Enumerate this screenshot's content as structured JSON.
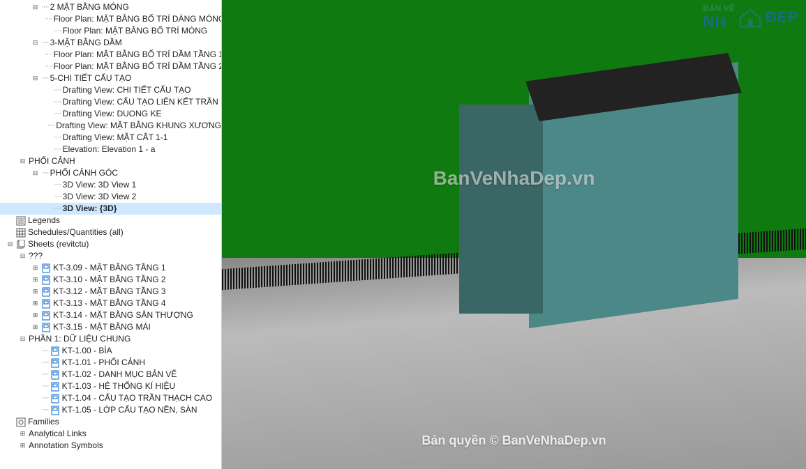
{
  "tree": [
    {
      "indent": 3,
      "exp": "minus",
      "label": "2 MẶT BẰNG MÓNG",
      "dotted": true
    },
    {
      "indent": 4,
      "exp": "none",
      "label": "Floor Plan: MẶT BẰNG BỐ TRÍ DÀNG MÓNG",
      "dotted": true
    },
    {
      "indent": 4,
      "exp": "none",
      "label": "Floor Plan: MẶT BẰNG BỐ TRÍ MÓNG",
      "dotted": true
    },
    {
      "indent": 3,
      "exp": "minus",
      "label": "3-MẶT BẰNG DẦM",
      "dotted": true
    },
    {
      "indent": 4,
      "exp": "none",
      "label": "Floor Plan: MẶT BẰNG BỐ TRÍ DẦM TẦNG 1",
      "dotted": true
    },
    {
      "indent": 4,
      "exp": "none",
      "label": "Floor Plan: MẶT BẰNG BỐ TRÍ DẦM TẦNG 2",
      "dotted": true
    },
    {
      "indent": 3,
      "exp": "minus",
      "label": "5-CHI TIẾT CẤU TẠO",
      "dotted": true
    },
    {
      "indent": 4,
      "exp": "none",
      "label": "Drafting View: CHI TIẾT CẤU TẠO",
      "dotted": true
    },
    {
      "indent": 4,
      "exp": "none",
      "label": "Drafting View: CẤU TẠO LIÊN KẾT TRẦN",
      "dotted": true
    },
    {
      "indent": 4,
      "exp": "none",
      "label": "Drafting View: DUONG KE",
      "dotted": true
    },
    {
      "indent": 4,
      "exp": "none",
      "label": "Drafting View: MẶT BẰNG KHUNG XƯƠNG",
      "dotted": true
    },
    {
      "indent": 4,
      "exp": "none",
      "label": "Drafting View: MẶT CẮT 1-1",
      "dotted": true
    },
    {
      "indent": 4,
      "exp": "none",
      "label": "Elevation: Elevation 1 - a",
      "dotted": true
    },
    {
      "indent": 2,
      "exp": "minus",
      "label": "PHỐI CẢNH",
      "dotted": false
    },
    {
      "indent": 3,
      "exp": "minus",
      "label": "PHỐI CẢNH GÓC",
      "dotted": true
    },
    {
      "indent": 4,
      "exp": "none",
      "label": "3D View: 3D View 1",
      "dotted": true
    },
    {
      "indent": 4,
      "exp": "none",
      "label": "3D View: 3D View 2",
      "dotted": true
    },
    {
      "indent": 4,
      "exp": "none",
      "label": "3D View: {3D}",
      "dotted": true,
      "selected": true
    },
    {
      "indent": 1,
      "exp": "none",
      "icon": "legend",
      "label": "Legends",
      "dotted": false
    },
    {
      "indent": 1,
      "exp": "none",
      "icon": "sched",
      "label": "Schedules/Quantities (all)",
      "dotted": false
    },
    {
      "indent": 1,
      "exp": "minus",
      "icon": "sheets",
      "label": "Sheets (revitctu)",
      "dotted": false
    },
    {
      "indent": 2,
      "exp": "minus",
      "label": "???",
      "dotted": false
    },
    {
      "indent": 3,
      "exp": "plus",
      "icon": "sheet",
      "label": "KT-3.09 - MẶT BẰNG TẦNG 1",
      "dotted": false
    },
    {
      "indent": 3,
      "exp": "plus",
      "icon": "sheet",
      "label": "KT-3.10 - MẶT BẰNG TẦNG 2",
      "dotted": false
    },
    {
      "indent": 3,
      "exp": "plus",
      "icon": "sheet",
      "label": "KT-3.12 - MẶT BẰNG TẦNG 3",
      "dotted": false
    },
    {
      "indent": 3,
      "exp": "plus",
      "icon": "sheet",
      "label": "KT-3.13 - MẶT BẰNG TẦNG 4",
      "dotted": false
    },
    {
      "indent": 3,
      "exp": "plus",
      "icon": "sheet",
      "label": "KT-3.14 - MẶT BẰNG SÂN THƯỢNG",
      "dotted": false
    },
    {
      "indent": 3,
      "exp": "plus",
      "icon": "sheet",
      "label": "KT-3.15 - MẶT BẰNG MÁI",
      "dotted": false
    },
    {
      "indent": 2,
      "exp": "minus",
      "label": "PHẦN 1: DỮ LIỆU CHUNG",
      "dotted": false
    },
    {
      "indent": 3,
      "exp": "none",
      "icon": "sheet",
      "label": "KT-1.00 - BÌA",
      "dotted": true
    },
    {
      "indent": 3,
      "exp": "none",
      "icon": "sheet",
      "label": "KT-1.01 - PHỐI CẢNH",
      "dotted": true
    },
    {
      "indent": 3,
      "exp": "none",
      "icon": "sheet",
      "label": "KT-1.02 - DANH MỤC BẢN VẼ",
      "dotted": true
    },
    {
      "indent": 3,
      "exp": "none",
      "icon": "sheet",
      "label": "KT-1.03 - HỆ THỐNG KÍ HIỆU",
      "dotted": true
    },
    {
      "indent": 3,
      "exp": "none",
      "icon": "sheet",
      "label": "KT-1.04 - CẤU TẠO TRẦN THẠCH CAO",
      "dotted": true
    },
    {
      "indent": 3,
      "exp": "none",
      "icon": "sheet",
      "label": "KT-1.05 - LỚP CẤU TẠO NỀN, SÀN",
      "dotted": true
    },
    {
      "indent": 1,
      "exp": "none",
      "icon": "fam",
      "label": "Families",
      "dotted": false
    },
    {
      "indent": 2,
      "exp": "plus",
      "label": "Analytical Links",
      "dotted": false
    },
    {
      "indent": 2,
      "exp": "plus",
      "label": "Annotation Symbols",
      "dotted": false
    }
  ],
  "watermark_center": "BanVeNhaDep.vn",
  "watermark_bottom": "Bản quyền © BanVeNhaDep.vn",
  "logo": {
    "text1": "BẢN VẼ",
    "text2": "ĐẸP",
    "nh": "NH"
  }
}
